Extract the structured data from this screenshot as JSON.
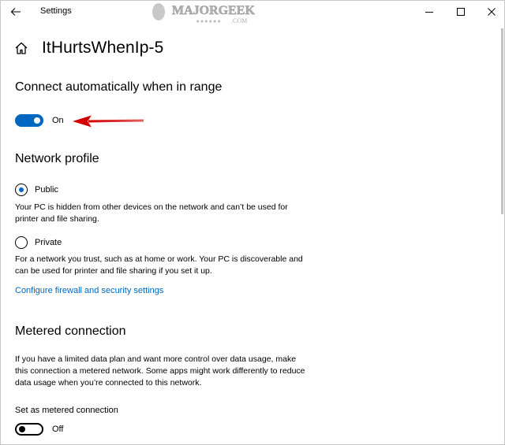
{
  "window": {
    "app_title": "Settings",
    "watermark": "MAJORGEEKS",
    "watermark_sub": ".COM"
  },
  "page": {
    "title": "ItHurtsWhenIp-5"
  },
  "auto_connect": {
    "heading": "Connect automatically when in range",
    "state": "On"
  },
  "network_profile": {
    "heading": "Network profile",
    "public": {
      "label": "Public",
      "description": "Your PC is hidden from other devices on the network and can’t be used for printer and file sharing.",
      "selected": true
    },
    "private": {
      "label": "Private",
      "description": "For a network you trust, such as at home or work. Your PC is discoverable and can be used for printer and file sharing if you set it up.",
      "selected": false
    },
    "firewall_link": "Configure firewall and security settings"
  },
  "metered": {
    "heading": "Metered connection",
    "description": "If you have a limited data plan and want more control over data usage, make this connection a metered network. Some apps might work differently to reduce data usage when you’re connected to this network.",
    "toggle_label": "Set as metered connection",
    "state": "Off"
  },
  "colors": {
    "accent": "#0067c0",
    "arrow": "#d40000"
  }
}
